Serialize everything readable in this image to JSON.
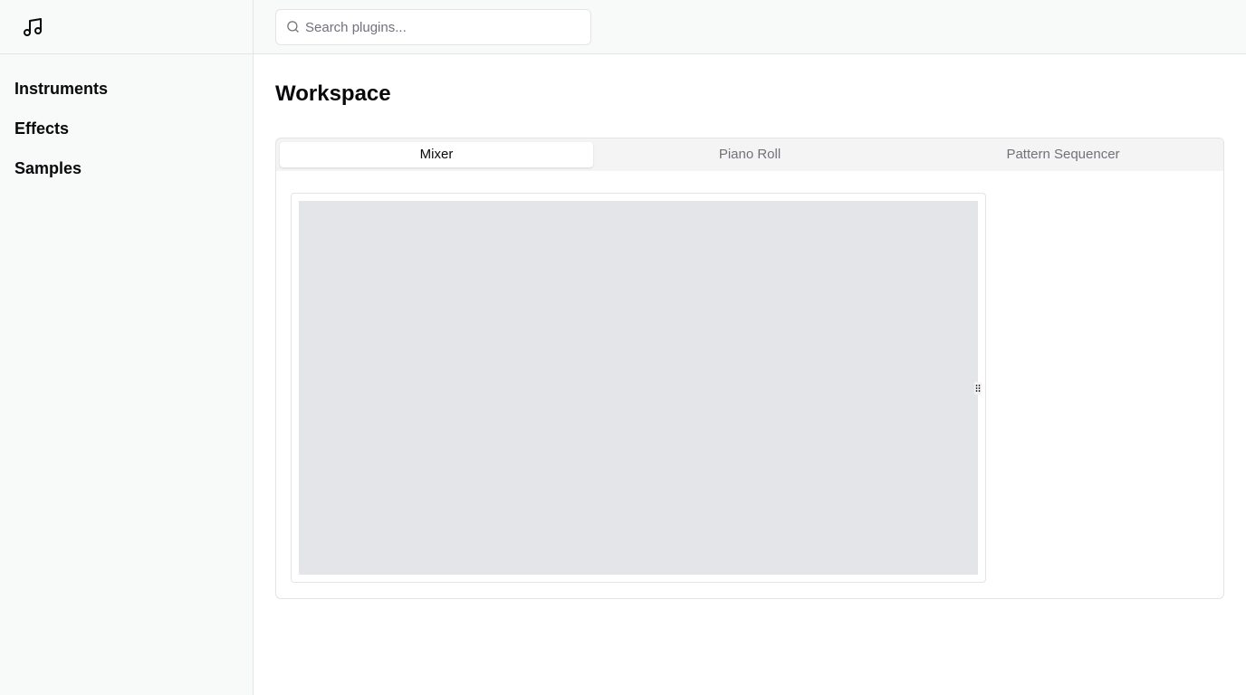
{
  "sidebar": {
    "logo_icon": "music-note-icon",
    "items": [
      {
        "label": "Instruments"
      },
      {
        "label": "Effects"
      },
      {
        "label": "Samples"
      }
    ]
  },
  "search": {
    "placeholder": "Search plugins...",
    "value": "",
    "icon": "search-icon"
  },
  "main": {
    "title": "Workspace",
    "tabs": [
      {
        "label": "Mixer",
        "active": true
      },
      {
        "label": "Piano Roll",
        "active": false
      },
      {
        "label": "Pattern Sequencer",
        "active": false
      }
    ]
  },
  "colors": {
    "sidebar_bg": "#f8f9f9",
    "border": "#e4e4e7",
    "muted_text": "#71717a",
    "canvas_bg": "#e4e5e9"
  }
}
